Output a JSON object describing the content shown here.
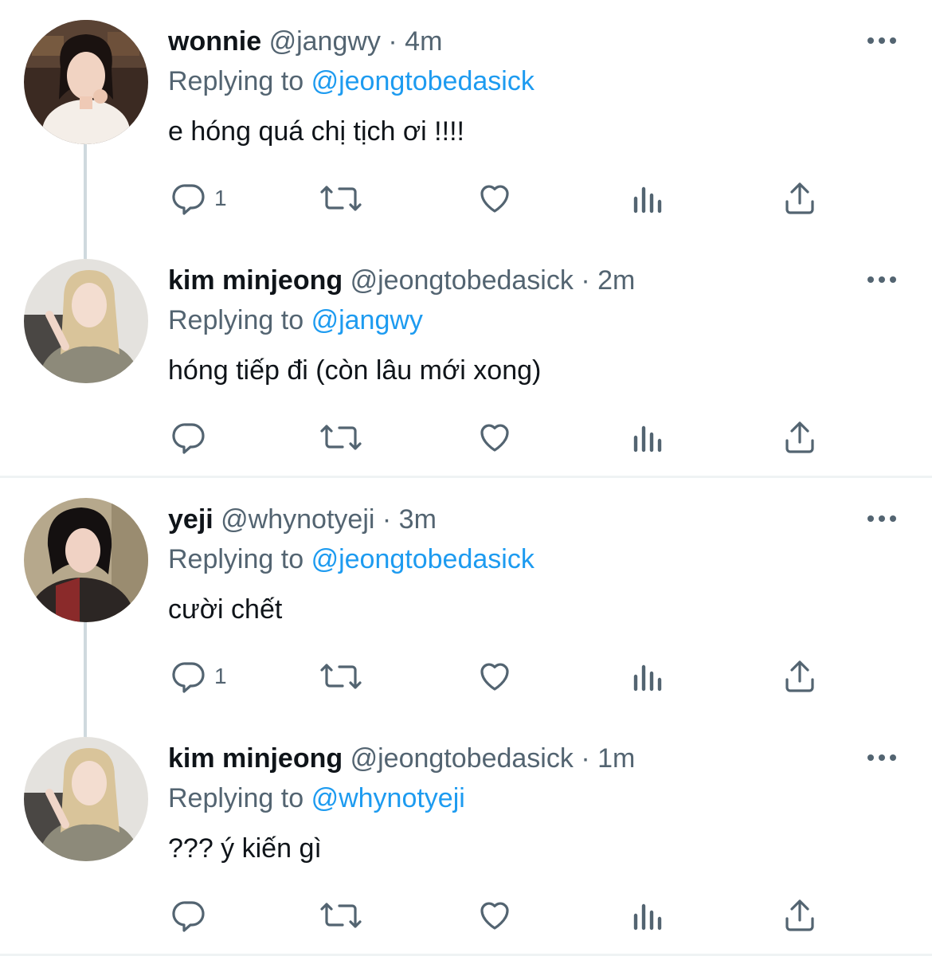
{
  "colors": {
    "link": "#1d9bf0",
    "secondary": "#536471",
    "primary": "#0f1419",
    "thread_line": "#cfd9de"
  },
  "tweets": [
    {
      "name": "wonnie",
      "handle": "@jangwy",
      "separator": "·",
      "time": "4m",
      "replying_label": "Replying to",
      "replying_to": "@jeongtobedasick",
      "text": "e hóng quá chị tịch ơi !!!!",
      "reply_count": "1",
      "avatar_icon": "avatar-wonnie"
    },
    {
      "name": "kim minjeong",
      "handle": "@jeongtobedasick",
      "separator": "·",
      "time": "2m",
      "replying_label": "Replying to",
      "replying_to": "@jangwy",
      "text": "hóng tiếp đi (còn lâu mới xong)",
      "reply_count": "",
      "avatar_icon": "avatar-minjeong"
    },
    {
      "name": "yeji",
      "handle": "@whynotyeji",
      "separator": "·",
      "time": "3m",
      "replying_label": "Replying to",
      "replying_to": "@jeongtobedasick",
      "text": "cười chết",
      "reply_count": "1",
      "avatar_icon": "avatar-yeji"
    },
    {
      "name": "kim minjeong",
      "handle": "@jeongtobedasick",
      "separator": "·",
      "time": "1m",
      "replying_label": "Replying to",
      "replying_to": "@whynotyeji",
      "text": "??? ý kiến gì",
      "reply_count": "",
      "avatar_icon": "avatar-minjeong"
    }
  ],
  "action_icons": [
    "reply-icon",
    "retweet-icon",
    "like-icon",
    "views-icon",
    "share-icon"
  ]
}
